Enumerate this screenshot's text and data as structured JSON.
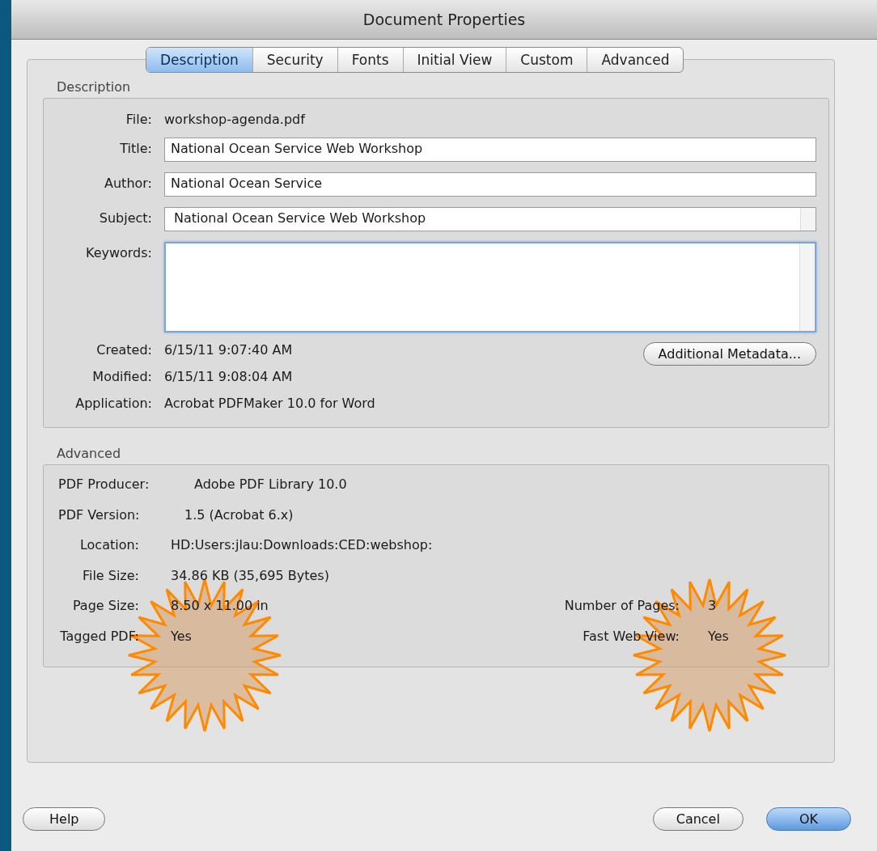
{
  "window": {
    "title": "Document Properties"
  },
  "tabs": [
    {
      "label": "Description",
      "selected": true
    },
    {
      "label": "Security",
      "selected": false
    },
    {
      "label": "Fonts",
      "selected": false
    },
    {
      "label": "Initial View",
      "selected": false
    },
    {
      "label": "Custom",
      "selected": false
    },
    {
      "label": "Advanced",
      "selected": false
    }
  ],
  "description": {
    "heading": "Description",
    "rows": [
      {
        "kind": "text",
        "label": "File:",
        "value": "workshop-agenda.pdf"
      },
      {
        "kind": "field",
        "label": "Title:",
        "value": "National Ocean Service Web Workshop",
        "focused": false
      },
      {
        "kind": "field",
        "label": "Author:",
        "value": "National Ocean Service",
        "focused": false
      },
      {
        "kind": "scrollfield",
        "label": "Subject:",
        "value": "National Ocean Service Web Workshop",
        "focused": false
      },
      {
        "kind": "area",
        "label": "Keywords:",
        "focused": true
      }
    ],
    "dates": [
      {
        "label": "Created:",
        "value": "6/15/11 9:07:40 AM"
      },
      {
        "label": "Modified:",
        "value": "6/15/11 9:08:04 AM"
      },
      {
        "label": "Application:",
        "value": "Acrobat PDFMaker 10.0 for Word"
      }
    ],
    "metadata_button": "Additional Metadata..."
  },
  "advanced": {
    "heading": "Advanced",
    "rows": [
      {
        "label": "PDF Producer:",
        "value": "Adobe PDF Library 10.0"
      },
      {
        "label": "PDF Version:",
        "value": "1.5 (Acrobat 6.x)"
      },
      {
        "label": "Location:",
        "value": "HD:Users:jlau:Downloads:CED:webshop:"
      },
      {
        "label": "File Size:",
        "value": "34.86 KB (35,695 Bytes)"
      },
      {
        "label": "Page Size:",
        "value": "8.50 x 11.00 in",
        "right_label": "Number of Pages:",
        "right_value": "3"
      },
      {
        "label": "Tagged PDF:",
        "value": "Yes",
        "right_label": "Fast Web View:",
        "right_value": "Yes"
      }
    ]
  },
  "buttons": [
    {
      "label": "Help",
      "default": false
    },
    {
      "label": "Cancel",
      "default": false
    },
    {
      "label": "OK",
      "default": true
    }
  ]
}
